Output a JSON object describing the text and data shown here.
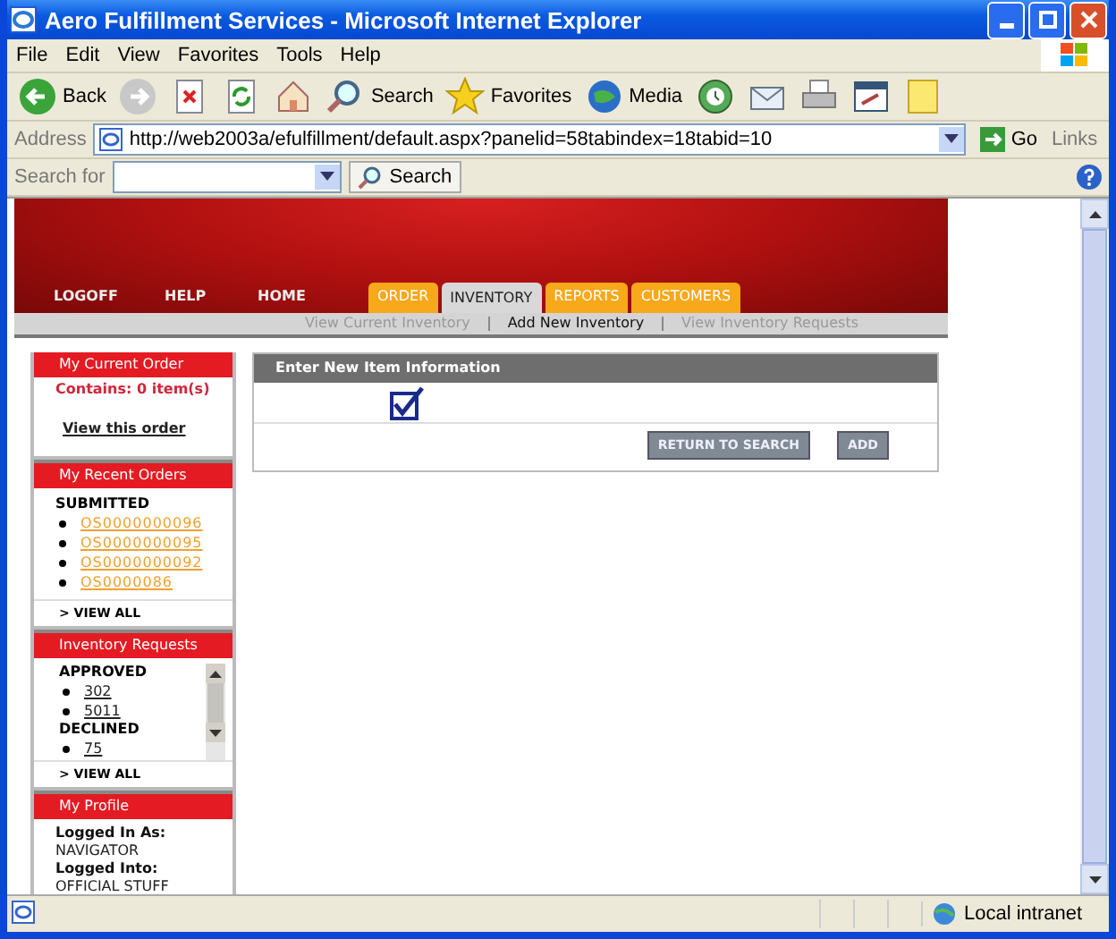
{
  "window": {
    "title": "Aero Fulfillment Services - Microsoft Internet Explorer"
  },
  "menu": [
    "File",
    "Edit",
    "View",
    "Favorites",
    "Tools",
    "Help"
  ],
  "toolbar": [
    {
      "kind": "back",
      "label": "Back"
    },
    {
      "kind": "forward"
    },
    {
      "kind": "stop"
    },
    {
      "kind": "refresh"
    },
    {
      "kind": "home"
    },
    {
      "kind": "search",
      "label": "Search"
    },
    {
      "kind": "favorites",
      "label": "Favorites"
    },
    {
      "kind": "media",
      "label": "Media"
    },
    {
      "kind": "history"
    },
    {
      "kind": "mail"
    },
    {
      "kind": "print"
    },
    {
      "kind": "edit"
    },
    {
      "kind": "note"
    }
  ],
  "address": {
    "label": "Address",
    "value": "http://web2003a/efulfillment/default.aspx?panelid=58tabindex=18tabid=10",
    "go": "Go",
    "links": "Links"
  },
  "search_bar": {
    "label": "Search for",
    "button": "Search"
  },
  "nav_links": [
    "LOGOFF",
    "HELP",
    "HOME"
  ],
  "tabs": [
    {
      "label": "ORDER",
      "selected": false
    },
    {
      "label": "INVENTORY",
      "selected": true
    },
    {
      "label": "REPORTS",
      "selected": false
    },
    {
      "label": "CUSTOMERS",
      "selected": false
    }
  ],
  "subnav": [
    {
      "label": "View Current Inventory",
      "selected": false
    },
    {
      "label": "Add New Inventory",
      "selected": true
    },
    {
      "label": "View Inventory Requests",
      "selected": false
    }
  ],
  "current_order": {
    "title": "My Current Order",
    "contains": "Contains: 0 item(s)",
    "link": "View this order"
  },
  "recent_orders": {
    "title": "My Recent Orders",
    "group": "SUBMITTED",
    "orders": [
      "OS0000000096",
      "OS0000000095",
      "OS0000000092",
      "OS0000086"
    ],
    "view_all": "> VIEW ALL"
  },
  "inventory_requests": {
    "title": "Inventory Requests",
    "groups": [
      {
        "label": "APPROVED",
        "items": [
          "302",
          "5011"
        ]
      },
      {
        "label": "DECLINED",
        "items": [
          "75"
        ]
      }
    ],
    "view_all": "> VIEW ALL"
  },
  "profile": {
    "title": "My Profile",
    "fields": [
      {
        "label": "Logged In As:",
        "value": "NAVIGATOR"
      },
      {
        "label": "Logged Into:",
        "value": "OFFICIAL STUFF"
      }
    ]
  },
  "panel": {
    "title": "Enter New Item Information",
    "checked": true,
    "buttons": [
      "RETURN TO SEARCH",
      "ADD"
    ]
  },
  "status_bar": {
    "zone": "Local intranet"
  }
}
